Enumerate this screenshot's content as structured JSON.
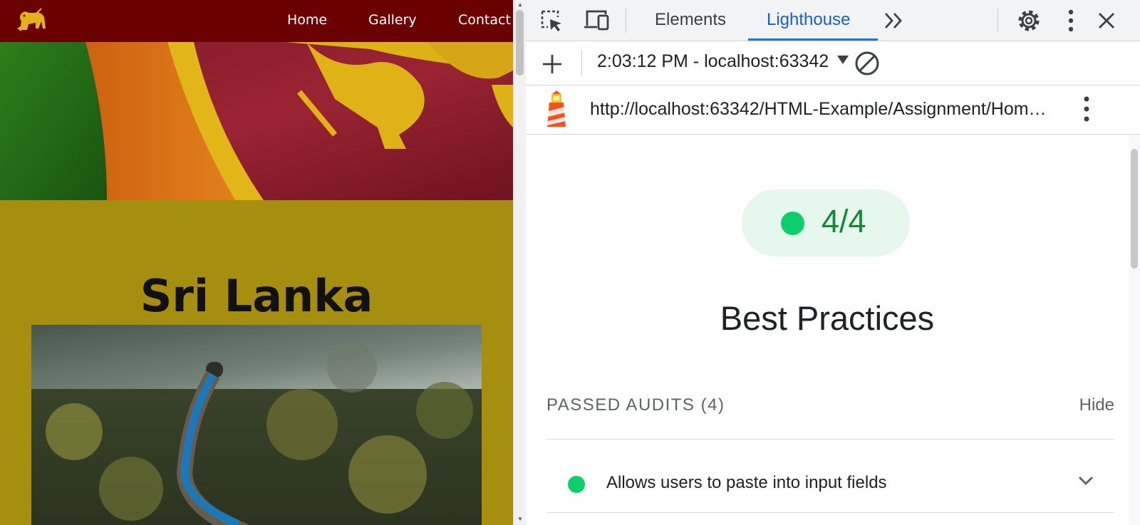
{
  "site": {
    "nav": {
      "links": [
        "Home",
        "Gallery",
        "Contact"
      ]
    },
    "heading": "Sri Lanka"
  },
  "devtools": {
    "tabs": {
      "elements": "Elements",
      "lighthouse": "Lighthouse"
    },
    "toolbar": {
      "report_label": "2:03:12 PM - localhost:63342"
    },
    "report_url": "http://localhost:63342/HTML-Example/Assignment/Hom…",
    "score": "4/4",
    "category": "Best Practices",
    "passed_audits": {
      "label": "PASSED AUDITS",
      "count": "(4)",
      "toggle": "Hide"
    },
    "audits": [
      {
        "title": "Allows users to paste into input fields",
        "status": "pass"
      }
    ]
  },
  "colors": {
    "nav_bg": "#6b0000",
    "page_bg": "#a68e0e",
    "accent_blue": "#1a73e8",
    "pass_green": "#0cce6b",
    "score_text": "#118a37",
    "score_pill_bg": "#e6f7ed"
  },
  "icons": [
    "lion-logo-icon",
    "inspect-element-icon",
    "device-toggle-icon",
    "more-tabs-icon",
    "settings-gear-icon",
    "kebab-menu-icon",
    "close-icon",
    "plus-icon",
    "dropdown-caret-icon",
    "clear-icon",
    "lighthouse-icon",
    "chevron-down-icon"
  ]
}
